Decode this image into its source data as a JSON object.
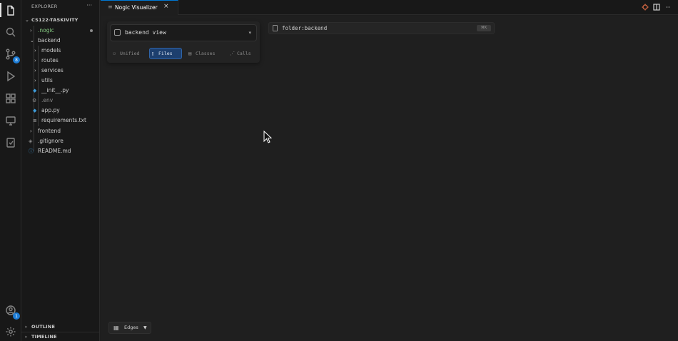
{
  "activity_bar": {
    "items": [
      {
        "name": "explorer",
        "icon": "files-icon",
        "active": true
      },
      {
        "name": "search",
        "icon": "search-icon"
      },
      {
        "name": "source-control",
        "icon": "source-control-icon",
        "badge": "8"
      },
      {
        "name": "run-debug",
        "icon": "run-debug-icon"
      },
      {
        "name": "extensions",
        "icon": "extensions-icon"
      },
      {
        "name": "remote-explorer",
        "icon": "remote-icon"
      },
      {
        "name": "testing",
        "icon": "testing-icon"
      }
    ],
    "bottom": [
      {
        "name": "accounts",
        "icon": "account-icon",
        "badge": "1"
      },
      {
        "name": "manage",
        "icon": "gear-icon"
      }
    ]
  },
  "sidebar": {
    "title": "EXPLORER",
    "more": "···",
    "root": "CS122-TASKIVITY",
    "tree": {
      "nogic": ".nogic",
      "backend": "backend",
      "models": "models",
      "routes": "routes",
      "services": "services",
      "utils": "utils",
      "init": "__init__.py",
      "env": ".env",
      "app": "app.py",
      "requirements": "requirements.txt",
      "frontend": "frontend",
      "gitignore": ".gitignore",
      "readme": "README.md"
    },
    "outline": "OUTLINE",
    "timeline": "TIMELINE"
  },
  "tabs": [
    {
      "label": "Nogic Visualizer",
      "close": "×"
    }
  ],
  "visualizer": {
    "view_select": "backend view",
    "modes": {
      "unified": "Unified",
      "files": "Files",
      "classes": "Classes",
      "calls": "Calls"
    },
    "active_mode": "Files",
    "search_value": "folder:backend",
    "search_shortcut": "⌘K",
    "edges_label": "Edges"
  },
  "colors": {
    "accent": "#0078d4",
    "active_mode_bg": "#1d3f6e",
    "python_icon": "#3d9bd8"
  }
}
